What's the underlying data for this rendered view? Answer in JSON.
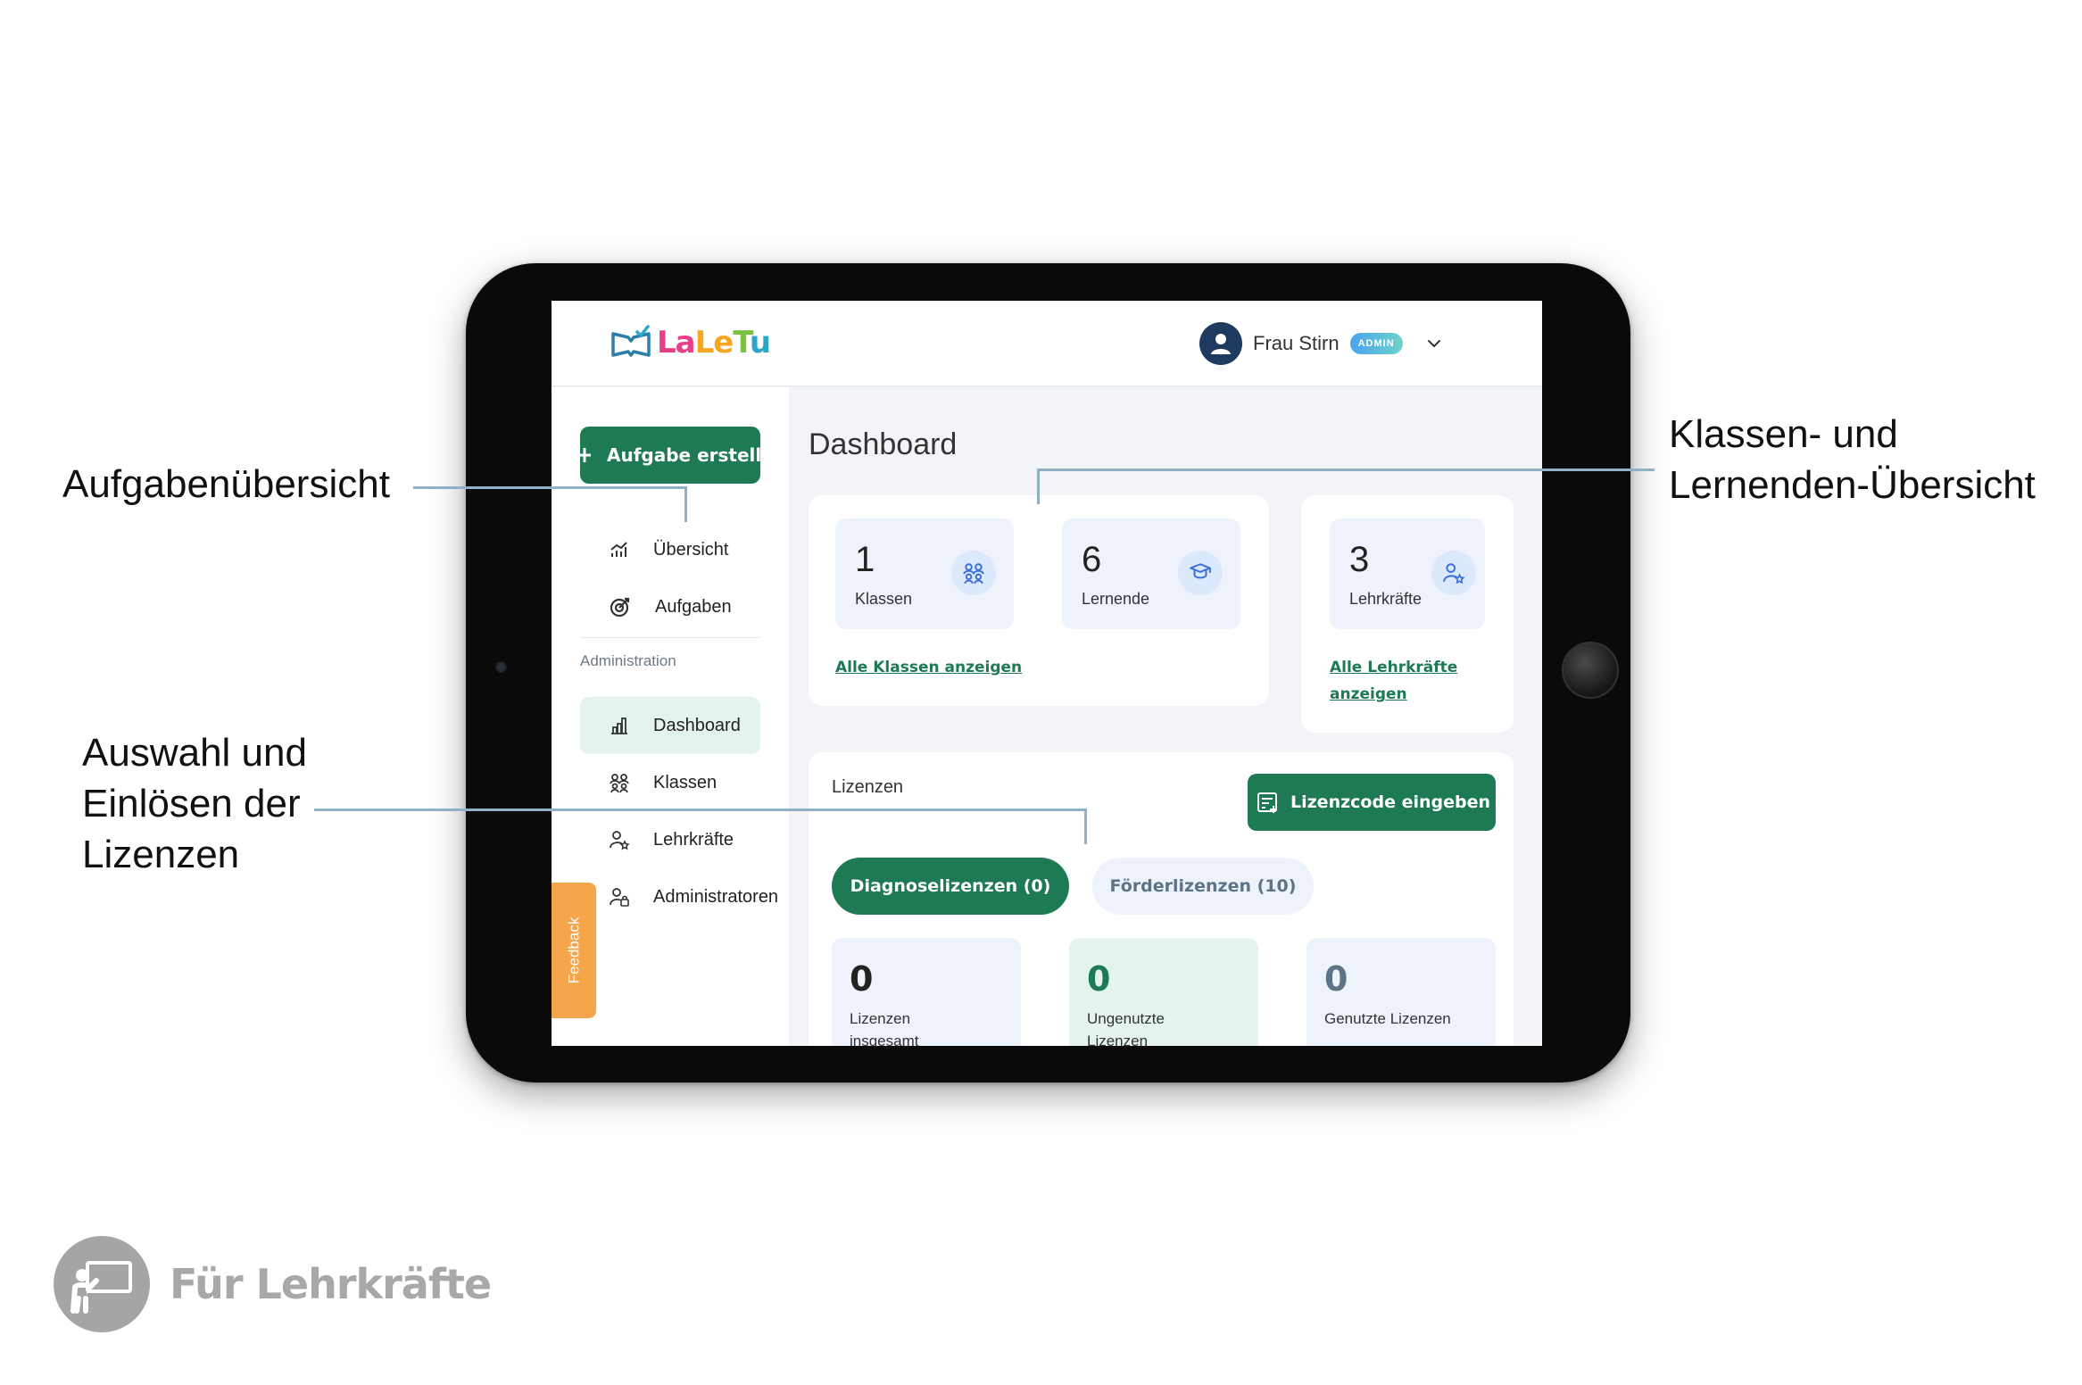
{
  "annotations": {
    "tasks": "Aufgabenübersicht",
    "classes_line1": "Klassen- und",
    "classes_line2": "Lernenden-Übersicht",
    "licenses_line1": "Auswahl und",
    "licenses_line2": "Einlösen der",
    "licenses_line3": "Lizenzen"
  },
  "header": {
    "logo_text": [
      "La",
      "Le",
      "T",
      "u"
    ],
    "user_name": "Frau Stirn",
    "role_badge": "ADMIN"
  },
  "sidebar": {
    "create_button": "Aufgabe erstellen",
    "items_top": [
      {
        "label": "Übersicht",
        "icon": "chart-icon"
      },
      {
        "label": "Aufgaben",
        "icon": "target-icon"
      }
    ],
    "section_label": "Administration",
    "items_admin": [
      {
        "label": "Dashboard",
        "icon": "bar-chart-icon",
        "active": true
      },
      {
        "label": "Klassen",
        "icon": "group-icon"
      },
      {
        "label": "Lehrkräfte",
        "icon": "teacher-icon"
      },
      {
        "label": "Administratoren",
        "icon": "admin-icon"
      }
    ],
    "feedback": "Feedback"
  },
  "main": {
    "title": "Dashboard",
    "stats": [
      {
        "value": "1",
        "label": "Klassen",
        "icon": "group-icon"
      },
      {
        "value": "6",
        "label": "Lernende",
        "icon": "graduation-icon"
      },
      {
        "value": "3",
        "label": "Lehrkräfte",
        "icon": "teacher-star-icon"
      }
    ],
    "link_classes": "Alle Klassen anzeigen",
    "link_teachers_line1": "Alle Lehrkräfte",
    "link_teachers_line2": "anzeigen",
    "licenses": {
      "title": "Lizenzen",
      "code_button": "Lizenzcode eingeben",
      "tabs": [
        {
          "label": "Diagnoselizenzen (0)",
          "active": true
        },
        {
          "label": "Förderlizenzen (10)",
          "active": false
        }
      ],
      "boxes": [
        {
          "value": "0",
          "label": "Lizenzen insgesamt",
          "color": "#222222"
        },
        {
          "value": "0",
          "label": "Ungenutzte Lizenzen",
          "color": "#1d7a52"
        },
        {
          "value": "0",
          "label": "Genutzte Lizenzen",
          "color": "#5d7486"
        }
      ]
    }
  },
  "footer": {
    "label": "Für Lehrkräfte"
  },
  "colors": {
    "primary_green": "#1d7a52",
    "active_bg": "#e4f4ec",
    "stat_bg": "#eef3fb",
    "feedback_orange": "#f5a54a",
    "leader_line": "#8fb1c4"
  }
}
